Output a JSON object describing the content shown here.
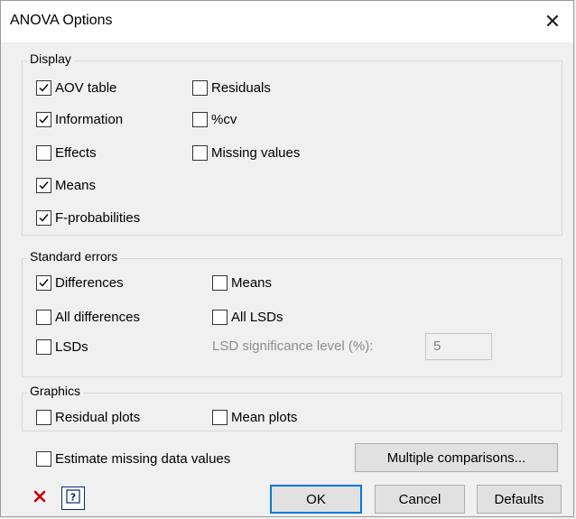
{
  "window": {
    "title": "ANOVA Options",
    "close_glyph": "✕"
  },
  "display": {
    "legend": "Display",
    "items": [
      {
        "label": "AOV table",
        "checked": true
      },
      {
        "label": "Information",
        "checked": true
      },
      {
        "label": "Effects",
        "checked": false
      },
      {
        "label": "Means",
        "checked": true
      },
      {
        "label": "F-probabilities",
        "checked": true
      },
      {
        "label": "Residuals",
        "checked": false
      },
      {
        "label": "%cv",
        "checked": false
      },
      {
        "label": "Missing values",
        "checked": false
      }
    ]
  },
  "standard_errors": {
    "legend": "Standard errors",
    "items": [
      {
        "label": "Differences",
        "checked": true
      },
      {
        "label": "All differences",
        "checked": false
      },
      {
        "label": "LSDs",
        "checked": false
      },
      {
        "label": "Means",
        "checked": false
      },
      {
        "label": "All LSDs",
        "checked": false
      }
    ],
    "lsd_label": "LSD significance level (%):",
    "lsd_value": "5"
  },
  "graphics": {
    "legend": "Graphics",
    "items": [
      {
        "label": "Residual plots",
        "checked": false
      },
      {
        "label": "Mean plots",
        "checked": false
      }
    ]
  },
  "estimate_missing": {
    "label": "Estimate missing data values",
    "checked": false
  },
  "buttons": {
    "multiple_comparisons": "Multiple comparisons...",
    "ok": "OK",
    "cancel": "Cancel",
    "defaults": "Defaults"
  },
  "icons": {
    "clear": "x-icon",
    "help": "help-icon",
    "clear_color": "#c00000",
    "help_color": "#0a246a",
    "accent": "#0078d7"
  }
}
